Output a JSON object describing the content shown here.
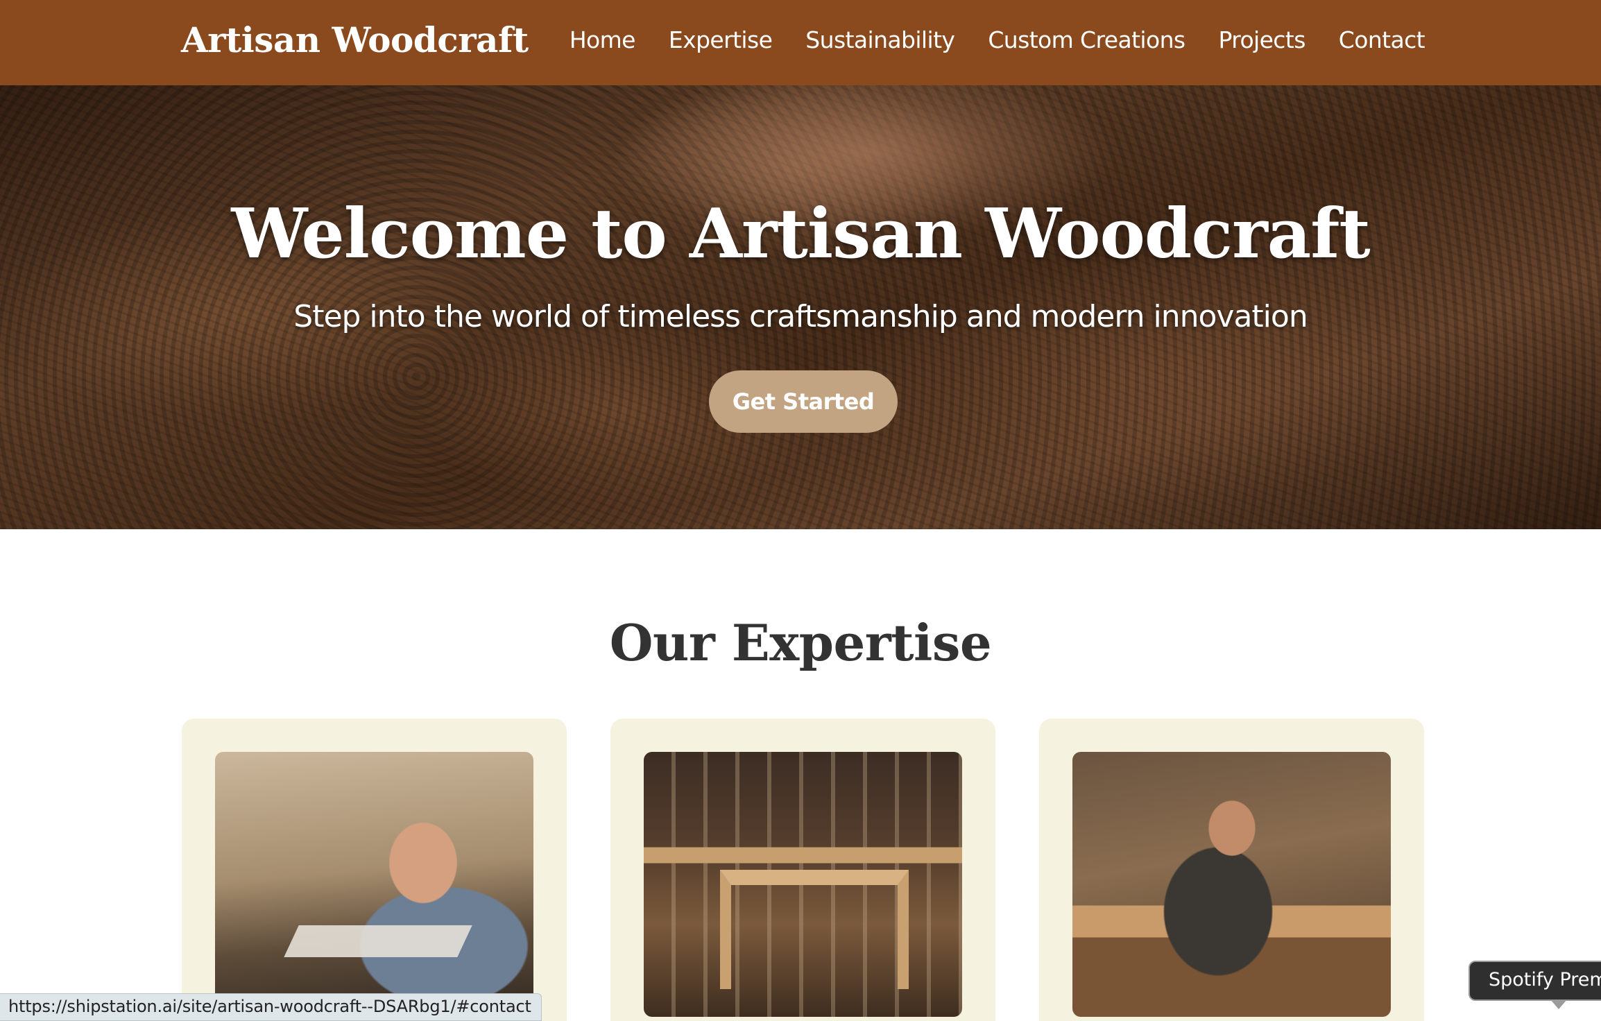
{
  "header": {
    "logo": "Artisan Woodcraft",
    "bg_color": "#8a4a1e",
    "nav": [
      {
        "label": "Home"
      },
      {
        "label": "Expertise"
      },
      {
        "label": "Sustainability"
      },
      {
        "label": "Custom Creations"
      },
      {
        "label": "Projects"
      },
      {
        "label": "Contact"
      }
    ]
  },
  "hero": {
    "title": "Welcome to Artisan Woodcraft",
    "subtitle": "Step into the world of timeless craftsmanship and modern innovation",
    "cta_label": "Get Started",
    "cta_color": "#c2a483"
  },
  "expertise": {
    "title": "Our Expertise",
    "card_bg": "#f5f3df",
    "cards": [
      {
        "image": "carpenter-sanding-photo"
      },
      {
        "image": "workshop-workbench-photo"
      },
      {
        "image": "woodworker-at-bench-photo"
      }
    ]
  },
  "status_bar": {
    "url": "https://shipstation.ai/site/artisan-woodcraft--DSARbg1/#contact"
  },
  "tooltip": {
    "text": "Spotify Premium"
  }
}
